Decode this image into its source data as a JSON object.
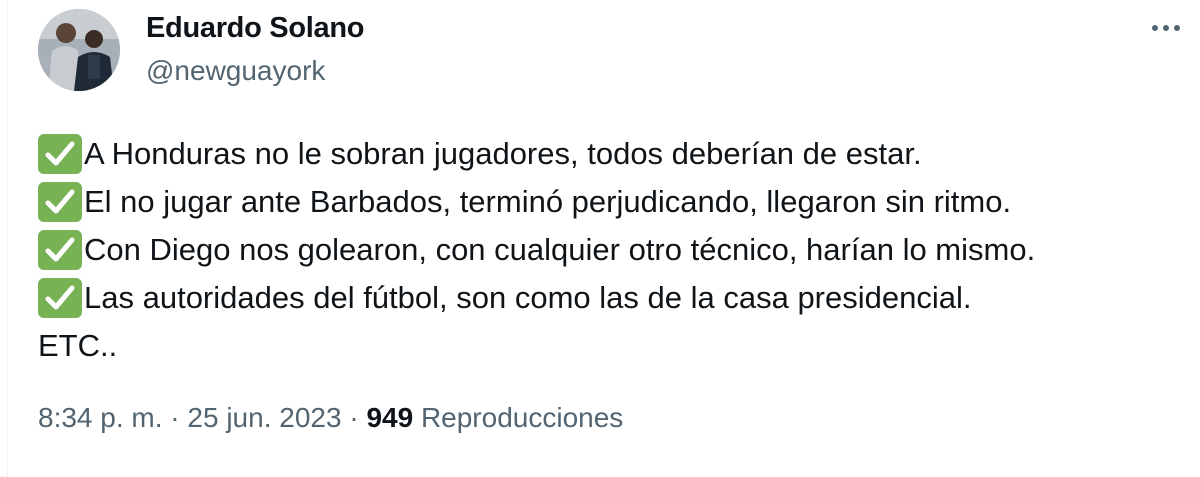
{
  "author": {
    "display_name": "Eduardo Solano",
    "handle": "@newguayork"
  },
  "more_button_icon": "more-horizontal-icon",
  "tweet": {
    "lines": [
      {
        "icon": "white-check-mark-emoji",
        "text": "A Honduras no le sobran jugadores, todos deberían de estar."
      },
      {
        "icon": "white-check-mark-emoji",
        "text": "El no jugar ante Barbados, terminó perjudicando, llegaron sin ritmo."
      },
      {
        "icon": "white-check-mark-emoji",
        "text": "Con Diego nos golearon, con cualquier otro técnico, harían lo mismo."
      },
      {
        "icon": "white-check-mark-emoji",
        "text": "Las autoridades del fútbol, son como las de la casa presidencial."
      },
      {
        "icon": "",
        "text": "ETC.."
      }
    ]
  },
  "meta": {
    "time": "8:34 p. m.",
    "separator": "·",
    "date": "25 jun. 2023",
    "views_count": "949",
    "views_label": "Reproducciones"
  },
  "colors": {
    "text_primary": "#0f1419",
    "text_secondary": "#536471",
    "check_emoji_bg": "#77b255"
  }
}
